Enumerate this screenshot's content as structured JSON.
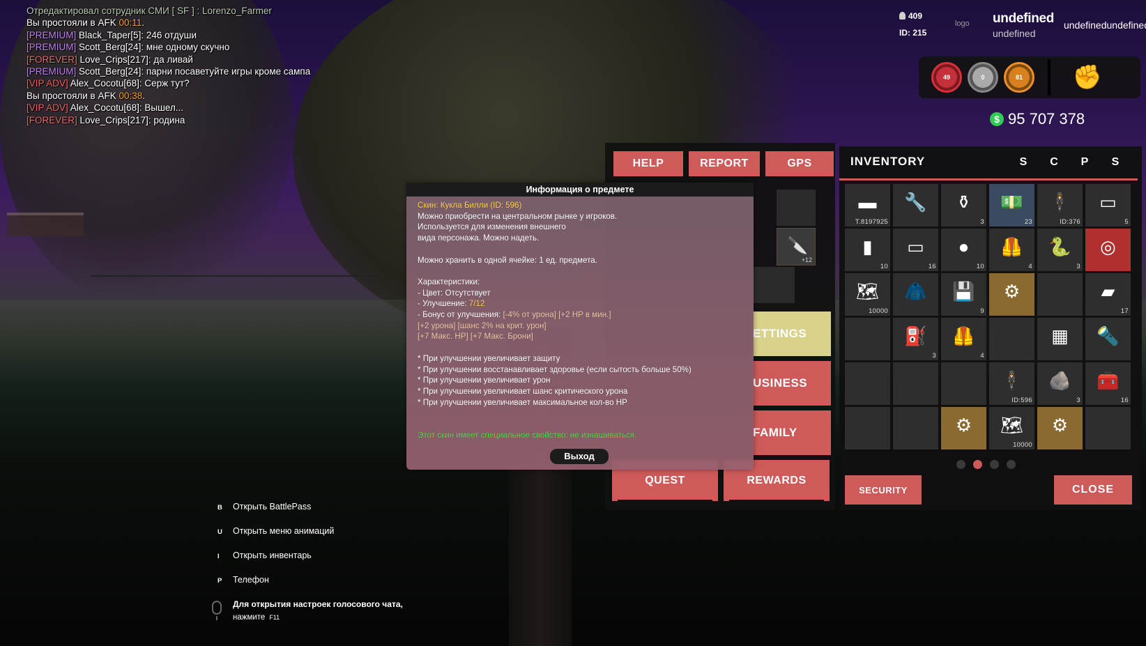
{
  "chat": [
    {
      "text": "   Отредактировал сотрудник СМИ [ SF ] : Lorenzo_Farmer",
      "color": "#b8c8b0"
    },
    {
      "segments": [
        {
          "t": "Вы простояли в AFK ",
          "c": "#ffffff"
        },
        {
          "t": "00:11",
          "c": "#f0a030"
        },
        {
          "t": ".",
          "c": "#ffffff"
        }
      ]
    },
    {
      "segments": [
        {
          "t": "[PREMIUM] ",
          "c": "#c080f0"
        },
        {
          "t": "Black_Taper[5]: 246 отдуши",
          "c": "#ffffff"
        }
      ]
    },
    {
      "segments": [
        {
          "t": "[PREMIUM] ",
          "c": "#c080f0"
        },
        {
          "t": "Scott_Berg[24]: мне одному скучно",
          "c": "#ffffff"
        }
      ]
    },
    {
      "segments": [
        {
          "t": "[FOREVER] ",
          "c": "#e07070"
        },
        {
          "t": "Love_Crips[217]: да ливай",
          "c": "#ffffff"
        }
      ]
    },
    {
      "segments": [
        {
          "t": "[PREMIUM] ",
          "c": "#c080f0"
        },
        {
          "t": "Scott_Berg[24]: парни посаветуйте игры кроме сампа",
          "c": "#ffffff"
        }
      ]
    },
    {
      "segments": [
        {
          "t": "[VIP ADV] ",
          "c": "#f06060"
        },
        {
          "t": "Alex_Cocotu[68]: Серж тут?",
          "c": "#ffffff"
        }
      ]
    },
    {
      "segments": [
        {
          "t": "Вы простояли в AFK ",
          "c": "#ffffff"
        },
        {
          "t": "00:38",
          "c": "#f0a030"
        },
        {
          "t": ".",
          "c": "#ffffff"
        }
      ]
    },
    {
      "segments": [
        {
          "t": "[VIP ADV] ",
          "c": "#f06060"
        },
        {
          "t": "Alex_Cocotu[68]: Вышел...",
          "c": "#ffffff"
        }
      ]
    },
    {
      "segments": [
        {
          "t": "[FOREVER] ",
          "c": "#e07070"
        },
        {
          "t": "Love_Crips[217]: родина",
          "c": "#ffffff"
        }
      ]
    }
  ],
  "hud": {
    "online": "409",
    "id_label": "ID: 215",
    "logo_alt": "logo",
    "server_name": "undefined",
    "server_sub": "undefined",
    "server_right": "undefinedundefined",
    "hp": "49",
    "armor": "0",
    "food": "81",
    "money": "95 707 378"
  },
  "menu": {
    "help": "HELP",
    "report": "REPORT",
    "gps": "GPS",
    "settings": "ETTINGS",
    "business": "USINESS",
    "family": "FAMILY",
    "quest": "QUEST",
    "rewards": "REWARDS",
    "slot_count": "+12"
  },
  "tooltip": {
    "title": "Информация о предмете",
    "name": "Скин: Кукла Билли (ID: 596)",
    "desc1": "Можно приобрести на центральном рынке у игроков.",
    "desc2": "Используется для изменения внешнего",
    "desc3": "вида персонажа. Можно надеть.",
    "storage": "Можно хранить в одной ячейке: 1 ед. предмета.",
    "char_head": "Характеристики:",
    "color": " - Цвет: Отсутствует",
    "upgrade_label": " - Улучшение: ",
    "upgrade_value": "7/12",
    "bonus_label": " - Бонус от улучшения: ",
    "bonus_value": "[-4% от урона] [+2 HP в мин.]",
    "bonus2": "[+2 урона] [шанс 2% на крит. урон]",
    "bonus3": "[+7 Макс. HP] [+7 Макс. Брони]",
    "p1": "* При улучшении увеличивает защиту",
    "p2": "* При улучшении восстанавливает здоровье (если сытость больше 50%)",
    "p3": "* При улучшении увеличивает урон",
    "p4": "* При улучшении увеличивает шанс критического урона",
    "p5": "* При улучшении увеличивает максимальное кол-во HP",
    "special": "Этот скин имеет специальное свойство: не изнашиваться.",
    "exit": "Выход"
  },
  "inventory": {
    "title": "INVENTORY",
    "tabs": [
      "S",
      "C",
      "P",
      "S"
    ],
    "cells": [
      {
        "icon": "▬",
        "count": "T.8197925",
        "style": ""
      },
      {
        "icon": "🔧",
        "count": "",
        "style": ""
      },
      {
        "icon": "⚱",
        "count": "3",
        "style": ""
      },
      {
        "icon": "💵",
        "count": "23",
        "style": "hl2"
      },
      {
        "icon": "🕴",
        "count": "ID:376",
        "style": ""
      },
      {
        "icon": "▭",
        "count": "5",
        "style": ""
      },
      {
        "icon": "▮",
        "count": "10",
        "style": ""
      },
      {
        "icon": "▭",
        "count": "16",
        "style": ""
      },
      {
        "icon": "●",
        "count": "10",
        "style": ""
      },
      {
        "icon": "🦺",
        "count": "4",
        "style": ""
      },
      {
        "icon": "🐍",
        "count": "3",
        "style": ""
      },
      {
        "icon": "◎",
        "count": "",
        "style": "red"
      },
      {
        "icon": "🗺",
        "count": "10000",
        "style": ""
      },
      {
        "icon": "🧥",
        "count": "",
        "style": ""
      },
      {
        "icon": "💾",
        "count": "9",
        "style": ""
      },
      {
        "icon": "⚙",
        "count": "",
        "style": "hl"
      },
      {
        "icon": "",
        "count": "",
        "style": ""
      },
      {
        "icon": "▰",
        "count": "17",
        "style": ""
      },
      {
        "icon": "",
        "count": "",
        "style": ""
      },
      {
        "icon": "⛽",
        "count": "3",
        "style": ""
      },
      {
        "icon": "🦺",
        "count": "4",
        "style": ""
      },
      {
        "icon": "",
        "count": "",
        "style": ""
      },
      {
        "icon": "▦",
        "count": "",
        "style": ""
      },
      {
        "icon": "🔦",
        "count": "",
        "style": ""
      },
      {
        "icon": "",
        "count": "",
        "style": ""
      },
      {
        "icon": "",
        "count": "",
        "style": ""
      },
      {
        "icon": "",
        "count": "",
        "style": ""
      },
      {
        "icon": "🕴",
        "count": "ID:596",
        "style": ""
      },
      {
        "icon": "🪨",
        "count": "3",
        "style": ""
      },
      {
        "icon": "🧰",
        "count": "16",
        "style": ""
      },
      {
        "icon": "",
        "count": "",
        "style": ""
      },
      {
        "icon": "",
        "count": "",
        "style": ""
      },
      {
        "icon": "⚙",
        "count": "",
        "style": "hl"
      },
      {
        "icon": "🗺",
        "count": "10000",
        "style": ""
      },
      {
        "icon": "⚙",
        "count": "",
        "style": "hl"
      },
      {
        "icon": "",
        "count": "",
        "style": ""
      }
    ],
    "security": "SECURITY",
    "close": "CLOSE"
  },
  "hints": [
    {
      "key": "B",
      "label": "Открыть BattlePass"
    },
    {
      "key": "U",
      "label": "Открыть меню анимаций"
    },
    {
      "key": "I",
      "label": "Открыть инвентарь"
    },
    {
      "key": "P",
      "label": "Телефон"
    }
  ],
  "voice": {
    "line1": "Для открытия настроек голосового чата,",
    "line2": "нажмите",
    "key": "F11"
  }
}
